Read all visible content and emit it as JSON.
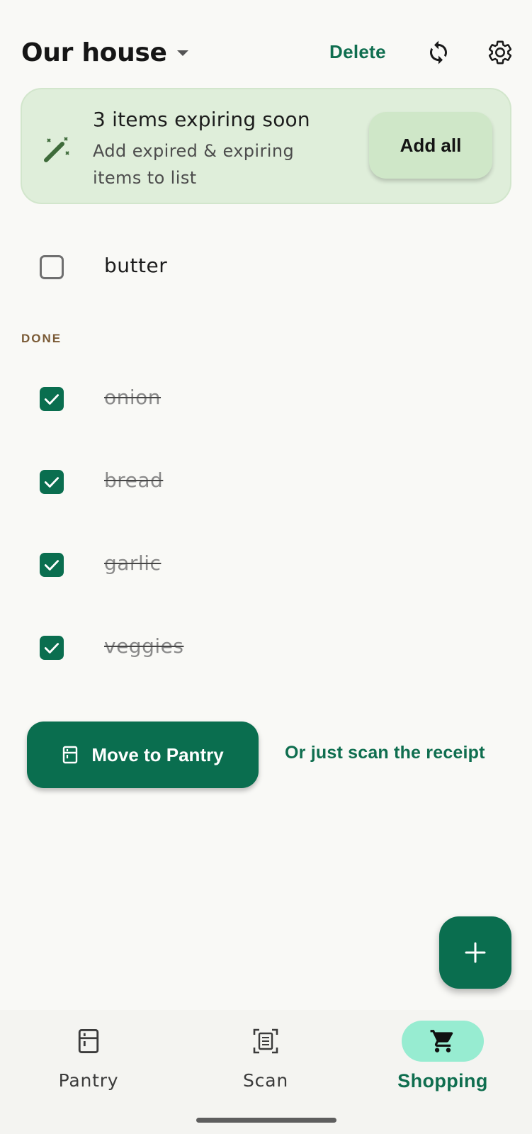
{
  "header": {
    "title": "Our house",
    "delete_label": "Delete"
  },
  "banner": {
    "title": "3 items expiring soon",
    "subtitle": "Add expired & expiring items to list",
    "add_all_label": "Add all"
  },
  "list": {
    "pending": [
      {
        "label": "butter",
        "checked": false
      }
    ],
    "done_header": "DONE",
    "done": [
      {
        "label": "onion",
        "checked": true
      },
      {
        "label": "bread",
        "checked": true
      },
      {
        "label": "garlic",
        "checked": true
      },
      {
        "label": "veggies",
        "checked": true
      }
    ]
  },
  "actions": {
    "move_label": "Move to Pantry",
    "scan_link": "Or just scan the receipt"
  },
  "nav": {
    "items": [
      {
        "label": "Pantry",
        "icon": "fridge-icon",
        "active": false
      },
      {
        "label": "Scan",
        "icon": "scan-icon",
        "active": false
      },
      {
        "label": "Shopping",
        "icon": "cart-icon",
        "active": true
      }
    ]
  },
  "colors": {
    "primary": "#0a6e4f",
    "banner_bg": "#dfeeda",
    "active_pill": "#97ecd1",
    "done_header": "#7a5a35"
  }
}
